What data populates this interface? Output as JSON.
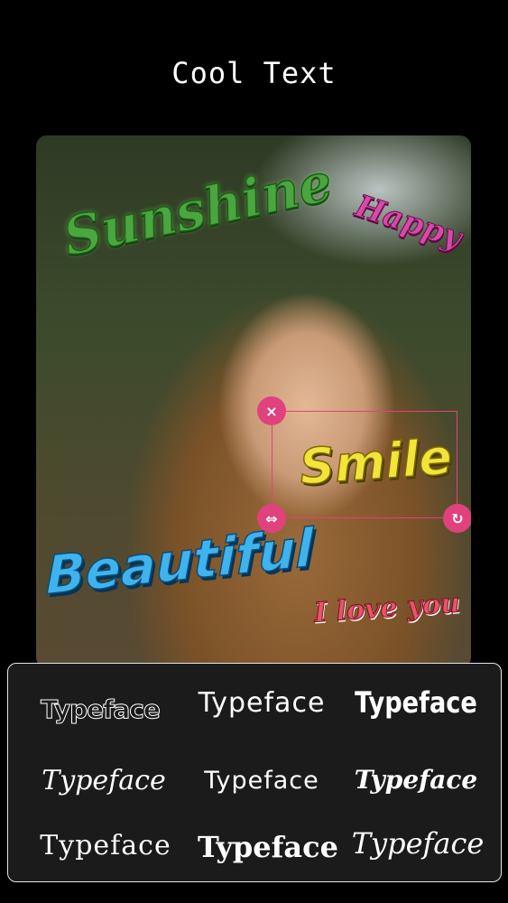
{
  "header": {
    "title": "Cool Text"
  },
  "canvas": {
    "stickers": {
      "sunshine": "Sunshine",
      "happy": "Happy",
      "smile": "Smile",
      "beautiful": "Beautiful",
      "iloveyou": "I love you"
    },
    "selection": {
      "close_icon": "×",
      "move_icon": "⇔",
      "rotate_icon": "↻"
    }
  },
  "font_panel": {
    "items": [
      "Typeface",
      "Typeface",
      "Typeface",
      "Typeface",
      "Typeface",
      "Typeface",
      "Typeface",
      "Typeface",
      "Typeface"
    ]
  },
  "colors": {
    "accent": "#e0427e",
    "background": "#000000",
    "panel": "#1b1b1c"
  }
}
